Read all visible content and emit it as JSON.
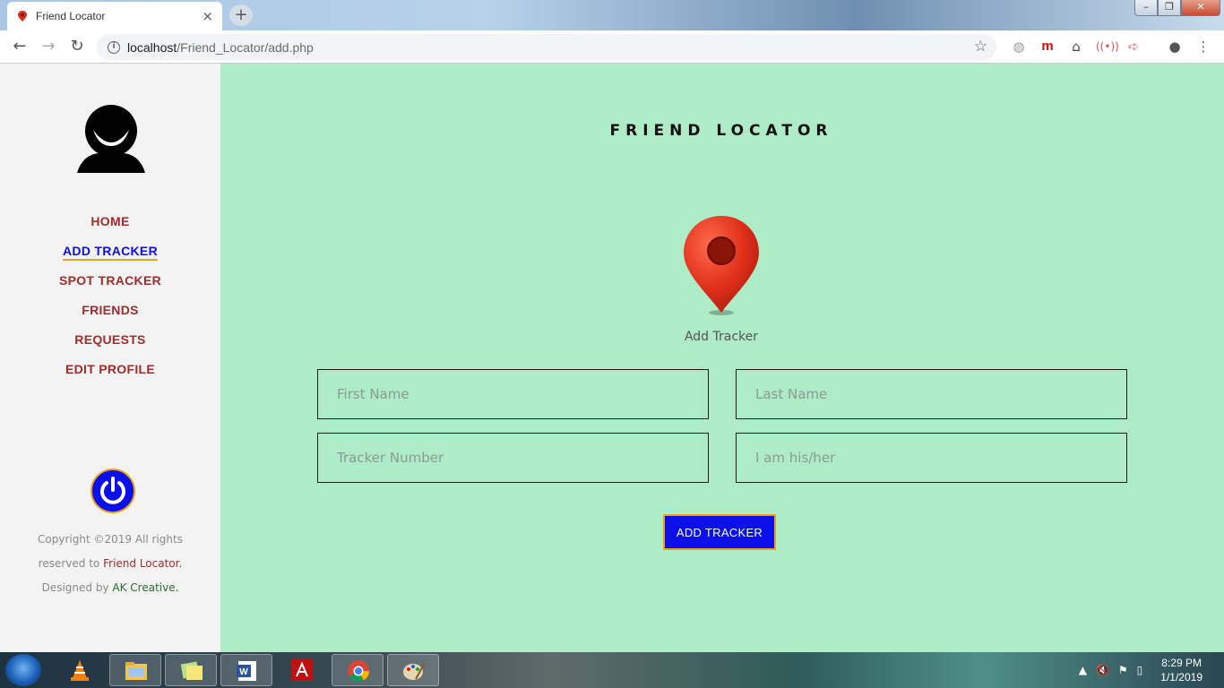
{
  "browser": {
    "tab_title": "Friend Locator",
    "tab_close": "×",
    "new_tab": "+",
    "url_host": "localhost",
    "url_path": "/Friend_Locator/add.php",
    "window_controls": {
      "minimize": "–",
      "maximize": "❐",
      "close": "✕"
    }
  },
  "sidebar": {
    "nav": [
      {
        "label": "HOME"
      },
      {
        "label": "ADD TRACKER",
        "active": true
      },
      {
        "label": "SPOT TRACKER"
      },
      {
        "label": "FRIENDS"
      },
      {
        "label": "REQUESTS"
      },
      {
        "label": "EDIT PROFILE"
      }
    ],
    "footer": {
      "copyright": "Copyright ©2019 All rights reserved to",
      "brand": "Friend Locator.",
      "designed_by": "Designed by",
      "designer": "AK Creative."
    }
  },
  "main": {
    "site_title": "FRIEND LOCATOR",
    "pin_label": "Add Tracker",
    "form": {
      "first_name_placeholder": "First Name",
      "last_name_placeholder": "Last Name",
      "tracker_number_placeholder": "Tracker Number",
      "relation_placeholder": "I am his/her",
      "submit_label": "ADD TRACKER"
    }
  },
  "taskbar": {
    "time": "8:29 PM",
    "date": "1/1/2019"
  },
  "colors": {
    "nav_text": "#a02c2c",
    "nav_active": "#0b10e8",
    "accent_border": "#e8a317",
    "main_bg": "#aeebc7",
    "sidebar_bg": "#f3f3f3"
  }
}
